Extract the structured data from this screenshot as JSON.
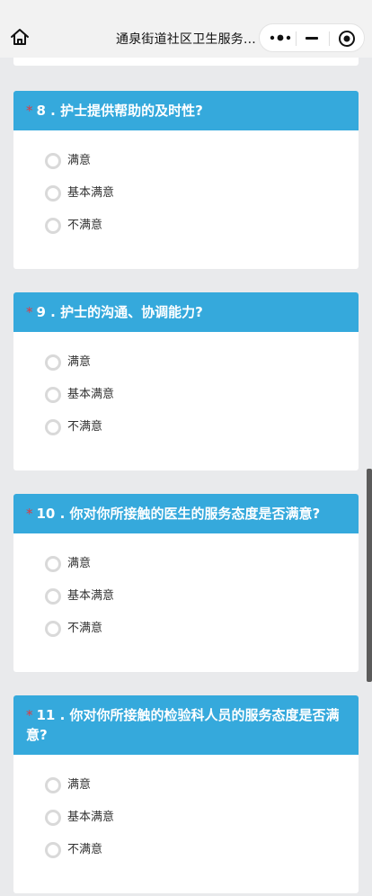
{
  "nav": {
    "title": "通泉街道社区卫生服务..."
  },
  "questions": [
    {
      "required_mark": "*",
      "title": "8 . 护士提供帮助的及时性?",
      "options": [
        "满意",
        "基本满意",
        "不满意"
      ]
    },
    {
      "required_mark": "*",
      "title": "9 . 护士的沟通、协调能力?",
      "options": [
        "满意",
        "基本满意",
        "不满意"
      ]
    },
    {
      "required_mark": "*",
      "title": "10 . 你对你所接触的医生的服务态度是否满意?",
      "options": [
        "满意",
        "基本满意",
        "不满意"
      ]
    },
    {
      "required_mark": "*",
      "title": "11 . 你对你所接触的检验科人员的服务态度是否满意?",
      "options": [
        "满意",
        "基本满意",
        "不满意"
      ]
    }
  ],
  "colors": {
    "header": "#35a9dc",
    "required": "#e0393e",
    "background": "#e9eaec"
  },
  "icons": {
    "home": "home-icon",
    "more": "more-dots-icon",
    "minimize": "minimize-icon",
    "close": "close-circle-icon"
  }
}
